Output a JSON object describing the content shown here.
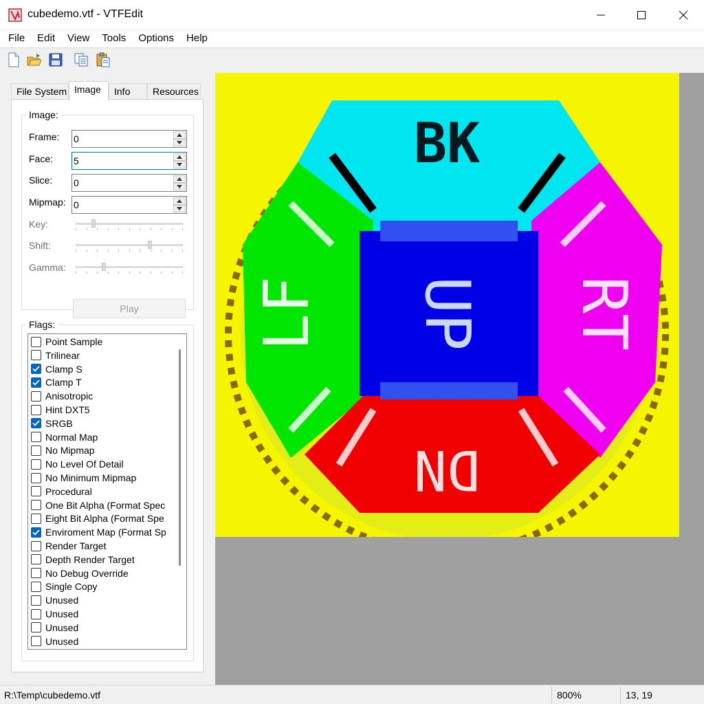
{
  "window": {
    "title": "cubedemo.vtf - VTFEdit"
  },
  "menu": [
    "File",
    "Edit",
    "View",
    "Tools",
    "Options",
    "Help"
  ],
  "toolbar": {
    "icons": [
      "new-file-icon",
      "open-folder-icon",
      "save-icon",
      "copy-icon",
      "paste-icon"
    ]
  },
  "tabs": [
    "File System",
    "Image",
    "Info",
    "Resources"
  ],
  "active_tab": "Image",
  "image_group": {
    "label": "Image:",
    "frame_label": "Frame:",
    "frame_value": "0",
    "face_label": "Face:",
    "face_value": "5",
    "slice_label": "Slice:",
    "slice_value": "0",
    "mipmap_label": "Mipmap:",
    "mipmap_value": "0",
    "key_label": "Key:",
    "key_level": 0.15,
    "shift_label": "Shift:",
    "shift_level": 0.7,
    "gamma_label": "Gamma:",
    "gamma_level": 0.25,
    "play_label": "Play"
  },
  "flags_group": {
    "label": "Flags:",
    "items": [
      {
        "label": "Point Sample",
        "checked": false
      },
      {
        "label": "Trilinear",
        "checked": false
      },
      {
        "label": "Clamp S",
        "checked": true
      },
      {
        "label": "Clamp T",
        "checked": true
      },
      {
        "label": "Anisotropic",
        "checked": false
      },
      {
        "label": "Hint DXT5",
        "checked": false
      },
      {
        "label": "SRGB",
        "checked": true
      },
      {
        "label": "Normal Map",
        "checked": false
      },
      {
        "label": "No Mipmap",
        "checked": false
      },
      {
        "label": "No Level Of Detail",
        "checked": false
      },
      {
        "label": "No Minimum Mipmap",
        "checked": false
      },
      {
        "label": "Procedural",
        "checked": false
      },
      {
        "label": "One Bit Alpha (Format Spec",
        "checked": false
      },
      {
        "label": "Eight Bit Alpha (Format Spe",
        "checked": false
      },
      {
        "label": "Enviroment Map (Format Sp",
        "checked": true
      },
      {
        "label": "Render Target",
        "checked": false
      },
      {
        "label": "Depth Render Target",
        "checked": false
      },
      {
        "label": "No Debug Override",
        "checked": false
      },
      {
        "label": "Single Copy",
        "checked": false
      },
      {
        "label": "Unused",
        "checked": false
      },
      {
        "label": "Unused",
        "checked": false
      },
      {
        "label": "Unused",
        "checked": false
      },
      {
        "label": "Unused",
        "checked": false
      }
    ]
  },
  "texture_preview": {
    "face_labels": [
      "BK",
      "UP",
      "LF",
      "RT",
      "DN"
    ],
    "colors": {
      "background": "#f5f500",
      "top": "#00e6f0",
      "center": "#0000e6",
      "left": "#00e600",
      "right": "#f000f0",
      "bottom": "#f00000",
      "viewport": "#a0a0a0"
    }
  },
  "status": {
    "path": "R:\\Temp\\cubedemo.vtf",
    "zoom": "800%",
    "coords": "13, 19"
  }
}
